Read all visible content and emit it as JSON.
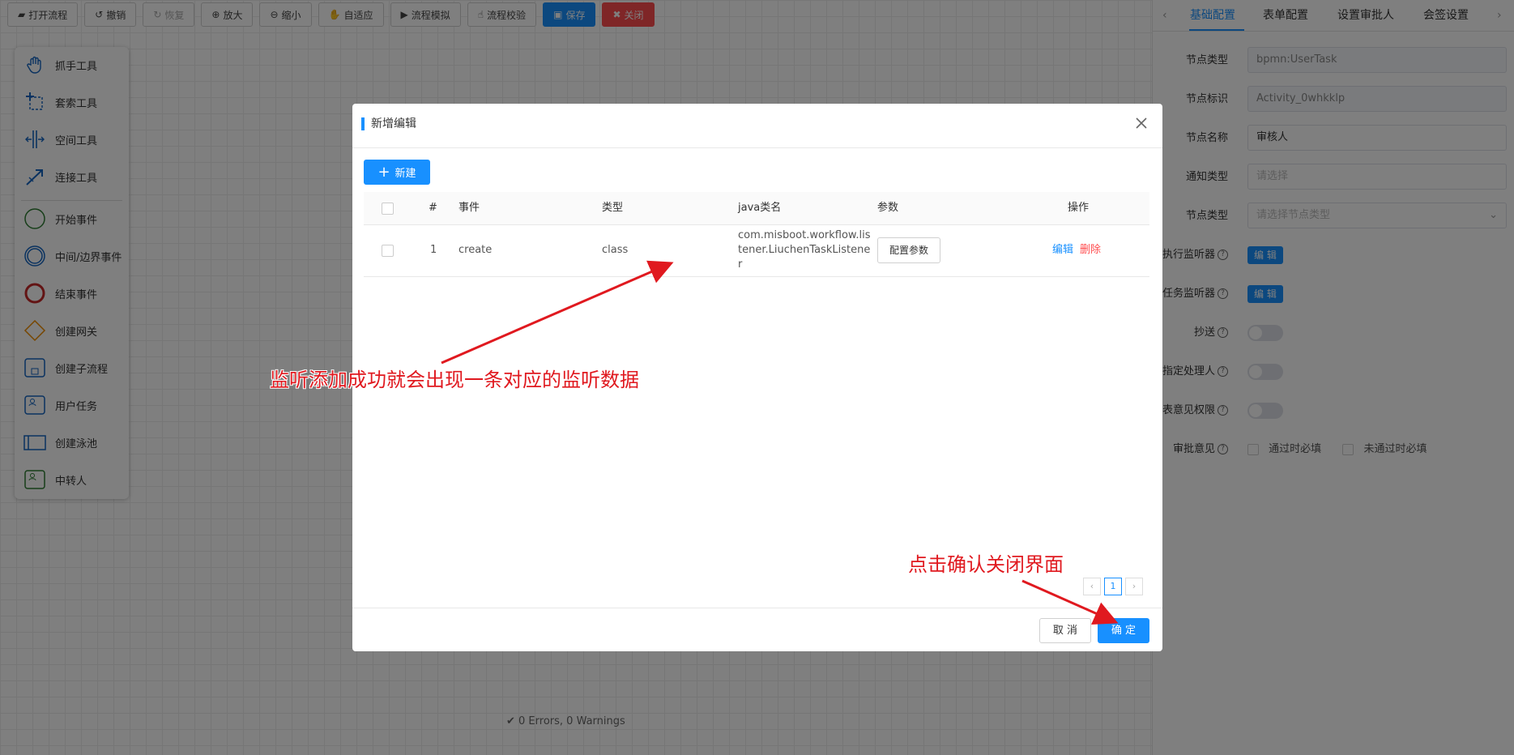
{
  "toolbar": {
    "open": "打开流程",
    "undo": "撤销",
    "redo": "恢复",
    "zoom_in": "放大",
    "zoom_out": "缩小",
    "fit": "自适应",
    "simulate": "流程模拟",
    "validate": "流程校验",
    "save": "保存",
    "close": "关闭"
  },
  "palette": {
    "items": [
      "抓手工具",
      "套索工具",
      "空间工具",
      "连接工具",
      "开始事件",
      "中间/边界事件",
      "结束事件",
      "创建网关",
      "创建子流程",
      "用户任务",
      "创建泳池",
      "中转人"
    ]
  },
  "panel": {
    "tabs": [
      "基础配置",
      "表单配置",
      "设置审批人",
      "会签设置"
    ],
    "fields": {
      "node_type_label": "节点类型",
      "node_type_value": "bpmn:UserTask",
      "node_id_label": "节点标识",
      "node_id_value": "Activity_0whkklp",
      "node_name_label": "节点名称",
      "node_name_value": "审核人",
      "notify_type_label": "通知类型",
      "notify_type_placeholder": "请选择",
      "node_kind_label": "节点类型",
      "node_kind_placeholder": "请选择节点类型",
      "exec_listener_label": "执行监听器",
      "task_listener_label": "任务监听器",
      "edit_label": "编 辑",
      "cc_label": "抄送",
      "assign_label": "指定处理人",
      "report_label": "报表意见权限",
      "approve_label": "审批意见",
      "pass_required": "通过时必填",
      "reject_required": "未通过时必填"
    }
  },
  "status": "0 Errors, 0 Warnings",
  "modal": {
    "title": "新增编辑",
    "new_button": "新建",
    "columns": [
      "#",
      "事件",
      "类型",
      "java类名",
      "参数",
      "操作"
    ],
    "rows": [
      {
        "index": "1",
        "event": "create",
        "type": "class",
        "java": "com.misboot.workflow.listener.LiuchenTaskListener",
        "param_button": "配置参数",
        "edit": "编辑",
        "delete": "删除"
      }
    ],
    "page": "1",
    "cancel": "取 消",
    "ok": "确 定"
  },
  "annotations": {
    "note1": "监听添加成功就会出现一条对应的监听数据",
    "note2": "点击确认关闭界面"
  },
  "colors": {
    "accent": "#1890ff",
    "danger": "#ff4d4f",
    "annotation": "#e0191f"
  }
}
